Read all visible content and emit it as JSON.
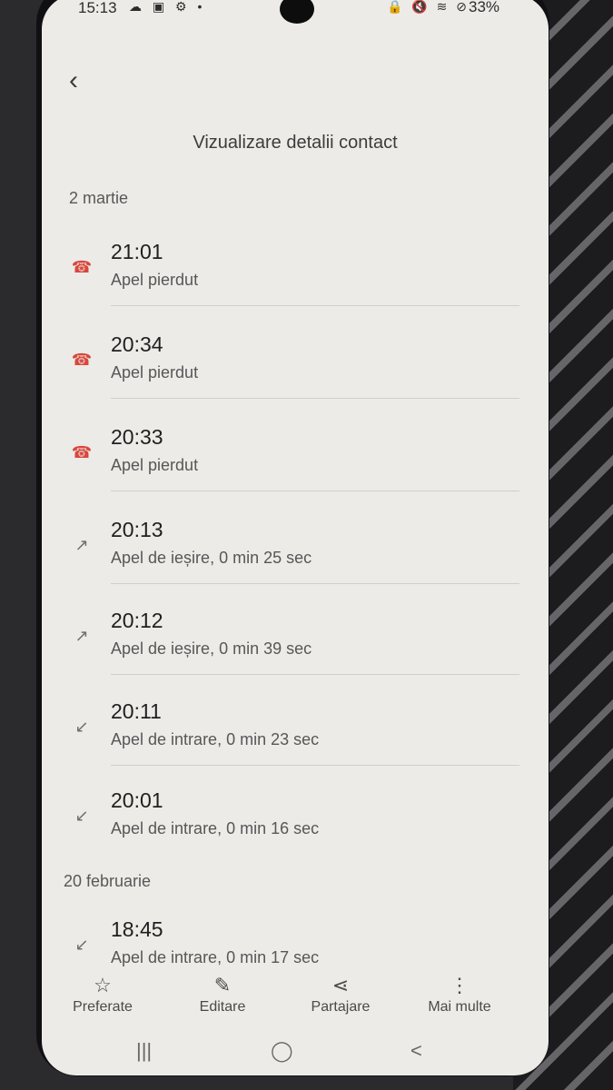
{
  "status_bar": {
    "time": "15:13",
    "left_icons": "☁ ▣ ⚙ •",
    "right_icons": "🔒 🔇 ≋ ⊘",
    "battery": "33%"
  },
  "header": {
    "title": "Vizualizare detalii contact"
  },
  "sections": [
    {
      "date": "2 martie",
      "calls": [
        {
          "time": "21:01",
          "desc": "Apel pierdut",
          "type": "missed"
        },
        {
          "time": "20:34",
          "desc": "Apel pierdut",
          "type": "missed"
        },
        {
          "time": "20:33",
          "desc": "Apel pierdut",
          "type": "missed"
        },
        {
          "time": "20:13",
          "desc": "Apel de ieșire, 0 min 25 sec",
          "type": "outgoing"
        },
        {
          "time": "20:12",
          "desc": "Apel de ieșire, 0 min 39 sec",
          "type": "outgoing"
        },
        {
          "time": "20:11",
          "desc": "Apel de intrare, 0 min 23 sec",
          "type": "incoming"
        },
        {
          "time": "20:01",
          "desc": "Apel de intrare, 0 min 16 sec",
          "type": "incoming"
        }
      ]
    },
    {
      "date": "20 februarie",
      "calls": [
        {
          "time": "18:45",
          "desc": "Apel de intrare, 0 min 17 sec",
          "type": "incoming"
        }
      ]
    }
  ],
  "actions": [
    {
      "label": "Preferate",
      "icon": "☆"
    },
    {
      "label": "Editare",
      "icon": "✎"
    },
    {
      "label": "Partajare",
      "icon": "⋖"
    },
    {
      "label": "Mai multe",
      "icon": "⋮"
    }
  ],
  "nav": {
    "recents": "|||",
    "home": "◯",
    "back": "<"
  },
  "colors": {
    "missed": "#d9473c",
    "screen_bg": "#ecebe8"
  }
}
